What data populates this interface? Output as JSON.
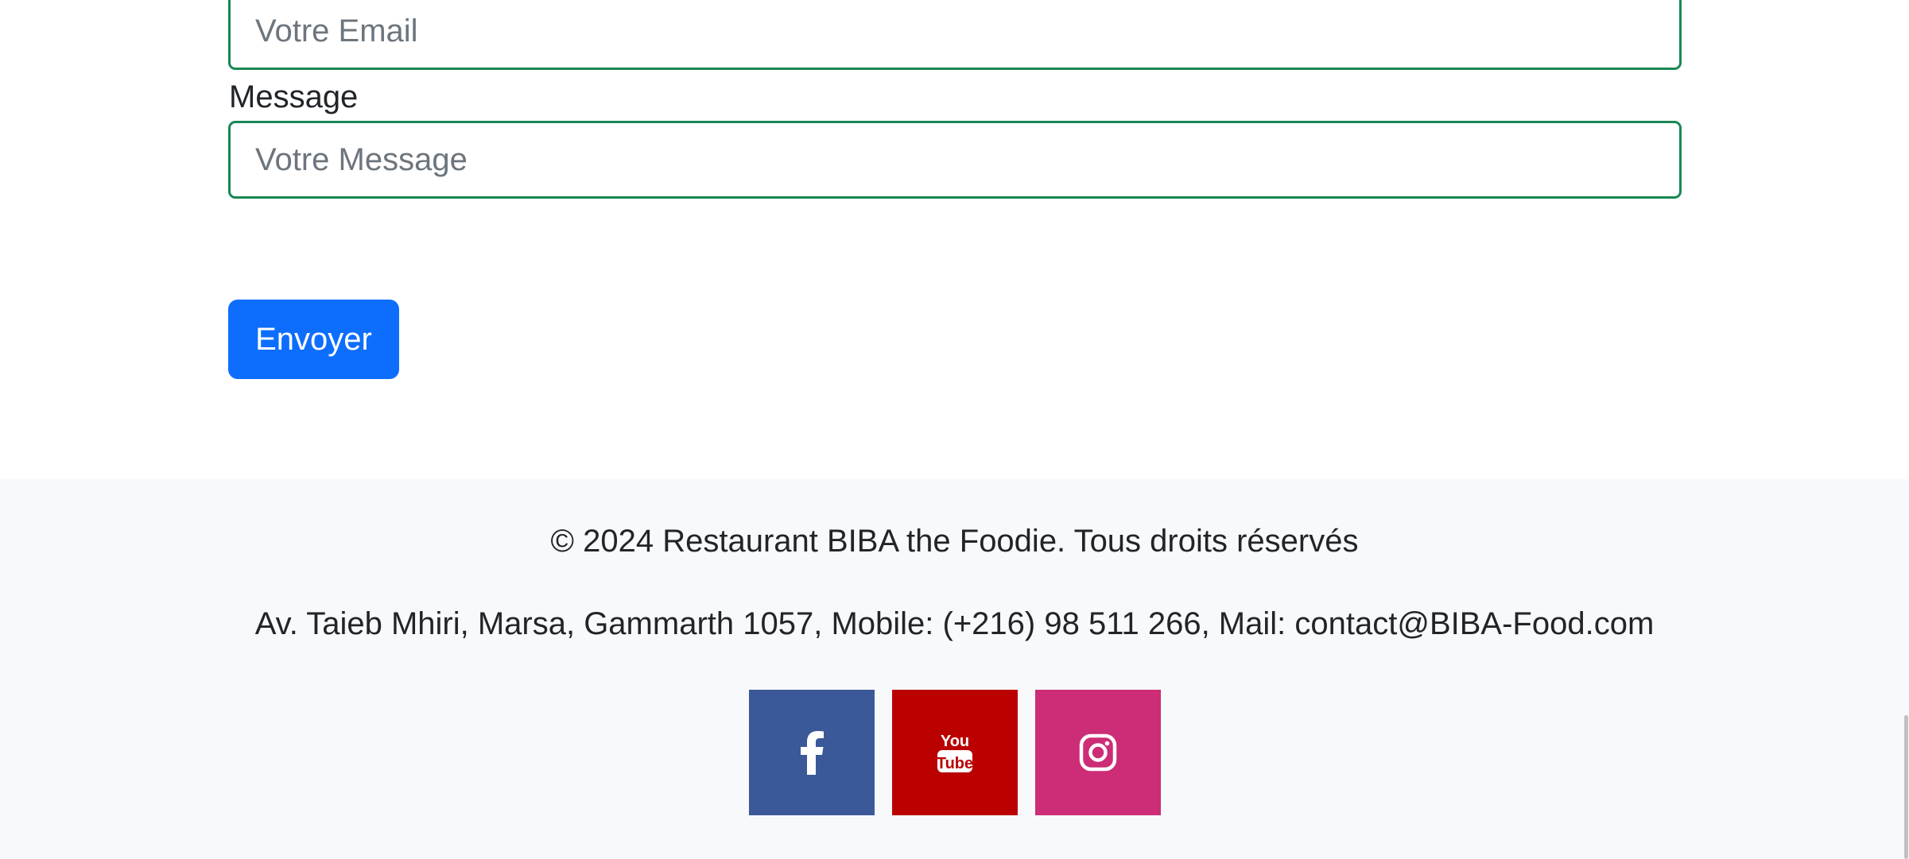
{
  "form": {
    "email_placeholder": "Votre Email",
    "message_label": "Message",
    "message_placeholder": "Votre Message",
    "submit_label": "Envoyer"
  },
  "footer": {
    "copyright": "© 2024 Restaurant BIBA the Foodie. Tous droits réservés",
    "address": "Av. Taieb Mhiri, Marsa, Gammarth 1057, Mobile: (+216) 98 511 266, Mail: contact@BIBA-Food.com",
    "socials": [
      {
        "name": "facebook",
        "icon": "facebook-icon",
        "color": "#3b5998"
      },
      {
        "name": "youtube",
        "icon": "youtube-icon",
        "color": "#bb0000"
      },
      {
        "name": "instagram",
        "icon": "instagram-icon",
        "color": "#cc2d76"
      }
    ]
  },
  "colors": {
    "input_border": "#198754",
    "primary_button": "#0d6efd",
    "footer_bg": "#f8f9fa"
  }
}
